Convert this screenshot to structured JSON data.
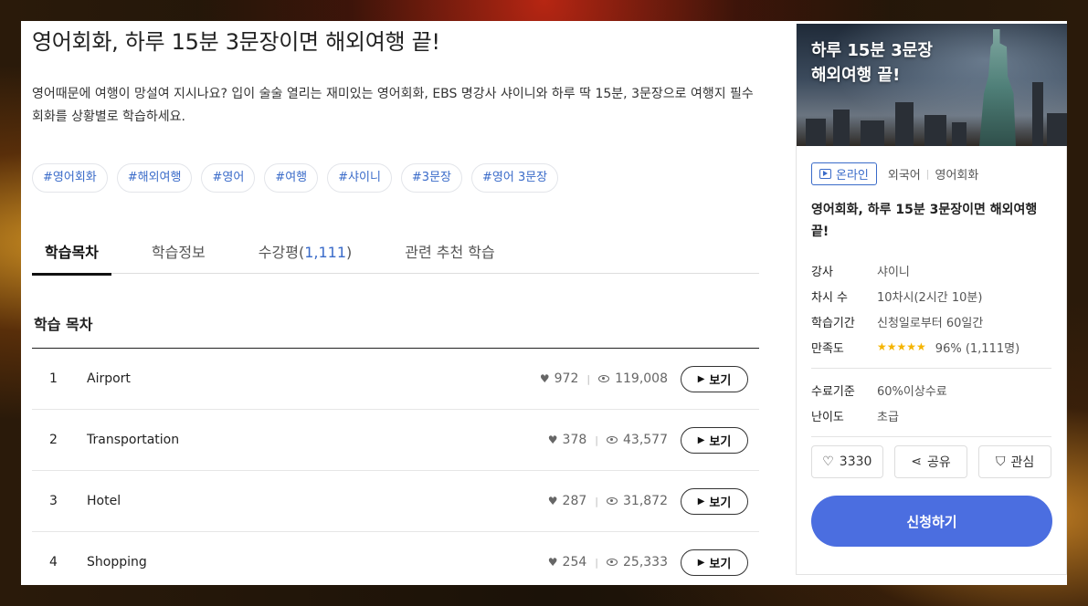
{
  "course": {
    "title": "영어회화, 하루 15분 3문장이면 해외여행 끝!",
    "description": "영어때문에 여행이 망설여 지시나요? 입이 술술 열리는 재미있는 영어회화, EBS 명강사 샤이니와 하루 딱 15분, 3문장으로 여행지 필수회화를 상황별로 학습하세요.",
    "tags": [
      "#영어회화",
      "#해외여행",
      "#영어",
      "#여행",
      "#샤이니",
      "#3문장",
      "#영어 3문장"
    ]
  },
  "tabs": [
    {
      "label": "학습목차"
    },
    {
      "label": "학습정보"
    },
    {
      "label": "수강평(",
      "count": "1,111",
      "suffix": ")"
    },
    {
      "label": "관련 추천 학습"
    }
  ],
  "toc": {
    "section_title": "학습 목차",
    "view_label": "보기",
    "rows": [
      {
        "num": "1",
        "title": "Airport",
        "likes": "972",
        "views": "119,008"
      },
      {
        "num": "2",
        "title": "Transportation",
        "likes": "378",
        "views": "43,577"
      },
      {
        "num": "3",
        "title": "Hotel",
        "likes": "287",
        "views": "31,872"
      },
      {
        "num": "4",
        "title": "Shopping",
        "likes": "254",
        "views": "25,333"
      }
    ]
  },
  "card": {
    "thumb_line1": "하루 15분 3문장",
    "thumb_line2": "해외여행 끝!",
    "badge": "온라인",
    "category1": "외국어",
    "category2": "영어회화",
    "title": "영어회화, 하루 15분 3문장이면 해외여행 끝!",
    "info": [
      {
        "key": "강사",
        "value": "샤이니"
      },
      {
        "key": "차시 수",
        "value": "10차시(2시간 10분)"
      },
      {
        "key": "학습기간",
        "value": "신청일로부터 60일간"
      }
    ],
    "rating": {
      "key": "만족도",
      "stars": "★★★★★",
      "value": "96% (1,111명)"
    },
    "info2": [
      {
        "key": "수료기준",
        "value": "60%이상수료"
      },
      {
        "key": "난이도",
        "value": "초급"
      }
    ],
    "like_count": "3330",
    "share_label": "공유",
    "fav_label": "관심",
    "apply_label": "신청하기"
  },
  "colors": {
    "accent": "#4b6ee0",
    "link": "#3a6bc9",
    "star": "#f5b400"
  }
}
